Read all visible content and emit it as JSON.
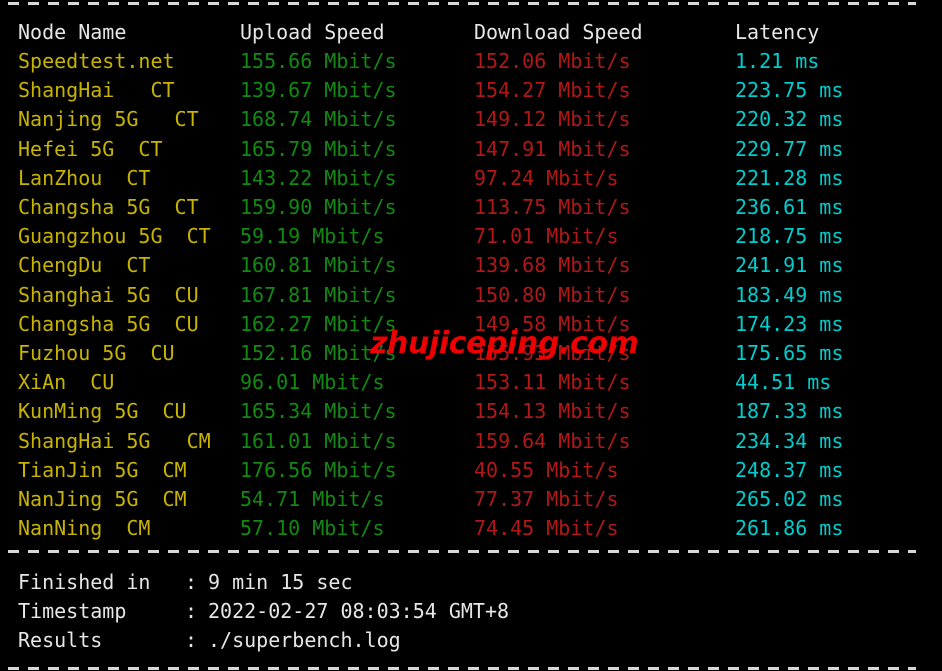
{
  "terminal": {
    "background": "#000000",
    "colors": {
      "header": "#e6e6e6",
      "node": "#c8b400",
      "upload": "#128a12",
      "download": "#b21818",
      "latency": "#00cdcd",
      "watermark": "#ee0000"
    }
  },
  "table": {
    "headers": {
      "node": "Node Name",
      "upload": "Upload Speed",
      "download": "Download Speed",
      "latency": "Latency"
    },
    "rows": [
      {
        "node": "Speedtest.net",
        "upload": "155.66 Mbit/s",
        "download": "152.06 Mbit/s",
        "latency": "1.21 ms"
      },
      {
        "node": "ShangHai   CT",
        "upload": "139.67 Mbit/s",
        "download": "154.27 Mbit/s",
        "latency": "223.75 ms"
      },
      {
        "node": "Nanjing 5G   CT",
        "upload": "168.74 Mbit/s",
        "download": "149.12 Mbit/s",
        "latency": "220.32 ms"
      },
      {
        "node": "Hefei 5G  CT",
        "upload": "165.79 Mbit/s",
        "download": "147.91 Mbit/s",
        "latency": "229.77 ms"
      },
      {
        "node": "LanZhou  CT",
        "upload": "143.22 Mbit/s",
        "download": "97.24 Mbit/s",
        "latency": "221.28 ms"
      },
      {
        "node": "Changsha 5G  CT",
        "upload": "159.90 Mbit/s",
        "download": "113.75 Mbit/s",
        "latency": "236.61 ms"
      },
      {
        "node": "Guangzhou 5G  CT",
        "upload": "59.19 Mbit/s",
        "download": "71.01 Mbit/s",
        "latency": "218.75 ms"
      },
      {
        "node": "ChengDu  CT",
        "upload": "160.81 Mbit/s",
        "download": "139.68 Mbit/s",
        "latency": "241.91 ms"
      },
      {
        "node": "Shanghai 5G  CU",
        "upload": "167.81 Mbit/s",
        "download": "150.80 Mbit/s",
        "latency": "183.49 ms"
      },
      {
        "node": "Changsha 5G  CU",
        "upload": "162.27 Mbit/s",
        "download": "149.58 Mbit/s",
        "latency": "174.23 ms"
      },
      {
        "node": "Fuzhou 5G  CU",
        "upload": "152.16 Mbit/s",
        "download": "155.93 Mbit/s",
        "latency": "175.65 ms"
      },
      {
        "node": "XiAn  CU",
        "upload": "96.01 Mbit/s",
        "download": "153.11 Mbit/s",
        "latency": "44.51 ms"
      },
      {
        "node": "KunMing 5G  CU",
        "upload": "165.34 Mbit/s",
        "download": "154.13 Mbit/s",
        "latency": "187.33 ms"
      },
      {
        "node": "ShangHai 5G   CM",
        "upload": "161.01 Mbit/s",
        "download": "159.64 Mbit/s",
        "latency": "234.34 ms"
      },
      {
        "node": "TianJin 5G  CM",
        "upload": "176.56 Mbit/s",
        "download": "40.55 Mbit/s",
        "latency": "248.37 ms"
      },
      {
        "node": "NanJing 5G  CM",
        "upload": "54.71 Mbit/s",
        "download": "77.37 Mbit/s",
        "latency": "265.02 ms"
      },
      {
        "node": "NanNing  CM",
        "upload": "57.10 Mbit/s",
        "download": "74.45 Mbit/s",
        "latency": "261.86 ms"
      }
    ]
  },
  "summary": [
    {
      "label": "Finished in",
      "colon": ":",
      "value": "9 min 15 sec"
    },
    {
      "label": "Timestamp",
      "colon": ":",
      "value": "2022-02-27 08:03:54 GMT+8"
    },
    {
      "label": "Results",
      "colon": ":",
      "value": "./superbench.log"
    }
  ],
  "watermark": {
    "text": "zhujiceping.com"
  }
}
